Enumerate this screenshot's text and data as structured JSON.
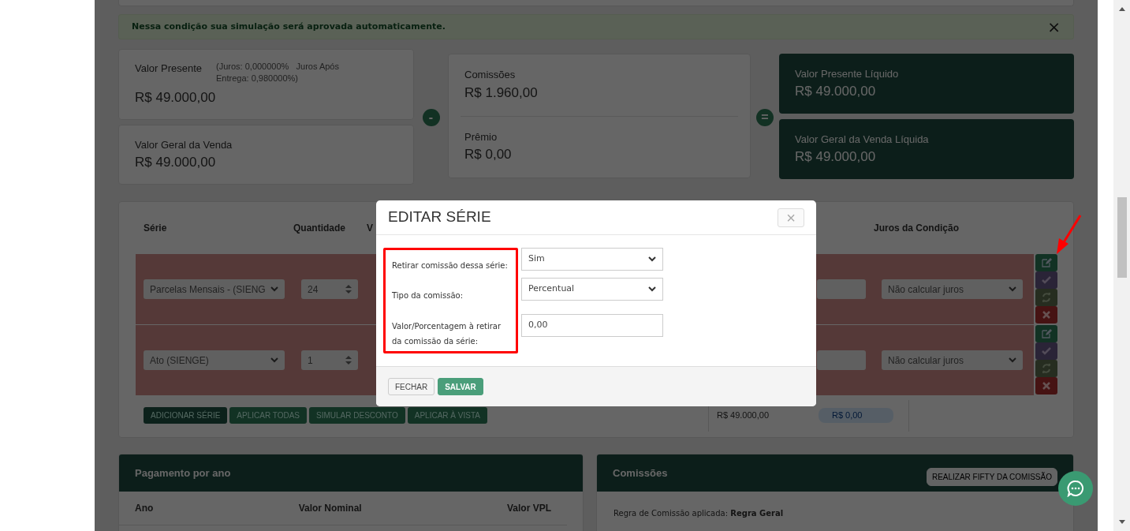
{
  "alert": {
    "text": "Nessa condição sua simulação será aprovada automaticamente.",
    "close": "×"
  },
  "summary": {
    "left": [
      {
        "label": "Valor Presente",
        "note": "(Juros: 0,000000%   Juros Após Entrega: 0,980000%)",
        "value": "R$ 49.000,00"
      },
      {
        "label": "Valor Geral da Venda",
        "value": "R$ 49.000,00"
      }
    ],
    "minus": "-",
    "middle": [
      {
        "label": "Comissões",
        "value": "R$ 1.960,00"
      },
      {
        "label": "Prêmio",
        "value": "R$ 0,00"
      }
    ],
    "equals": "=",
    "right": [
      {
        "label": "Valor Presente Líquido",
        "value": "R$ 49.000,00"
      },
      {
        "label": "Valor Geral da Venda Líquida",
        "value": "R$ 49.000,00"
      }
    ]
  },
  "series_table": {
    "columns": [
      "Série",
      "Quantidade",
      "V",
      "Juros da Condição"
    ],
    "rows": [
      {
        "serie": "Parcelas Mensais - (SIENG",
        "quantidade": "24",
        "juros": "Não calcular juros"
      },
      {
        "serie": "Ato (SIENGE)",
        "quantidade": "1",
        "juros": "Não calcular juros"
      }
    ],
    "buttons": [
      "ADICIONAR SÉRIE",
      "APLICAR TODAS",
      "SIMULAR DESCONTO",
      "APLICAR À VISTA"
    ],
    "totals": [
      "R$ 49.000,00",
      "R$ 0,00"
    ]
  },
  "payment_panel": {
    "title": "Pagamento por ano",
    "columns": [
      "Ano",
      "Valor Nominal",
      "Valor VPL"
    ]
  },
  "commission_panel": {
    "title": "Comissões",
    "button": "REALIZAR FIFTY DA COMISSÃO",
    "rule": "Regra de Comissão aplicada: **Regra Geral**"
  },
  "modal": {
    "title": "EDITAR SÉRIE",
    "close": "×",
    "fields": [
      {
        "kind": "select",
        "label": "Retirar comissão dessa série:",
        "value": "Sim"
      },
      {
        "kind": "select",
        "label": "Tipo da comissão:",
        "value": "Percentual"
      },
      {
        "kind": "input",
        "label": "Valor/Porcentagem à retirar da comissão da série:",
        "value": "0,00"
      }
    ],
    "buttons": [
      {
        "label": "FECHAR",
        "kind": "secondary"
      },
      {
        "label": "SALVAR",
        "kind": "primary"
      }
    ]
  }
}
